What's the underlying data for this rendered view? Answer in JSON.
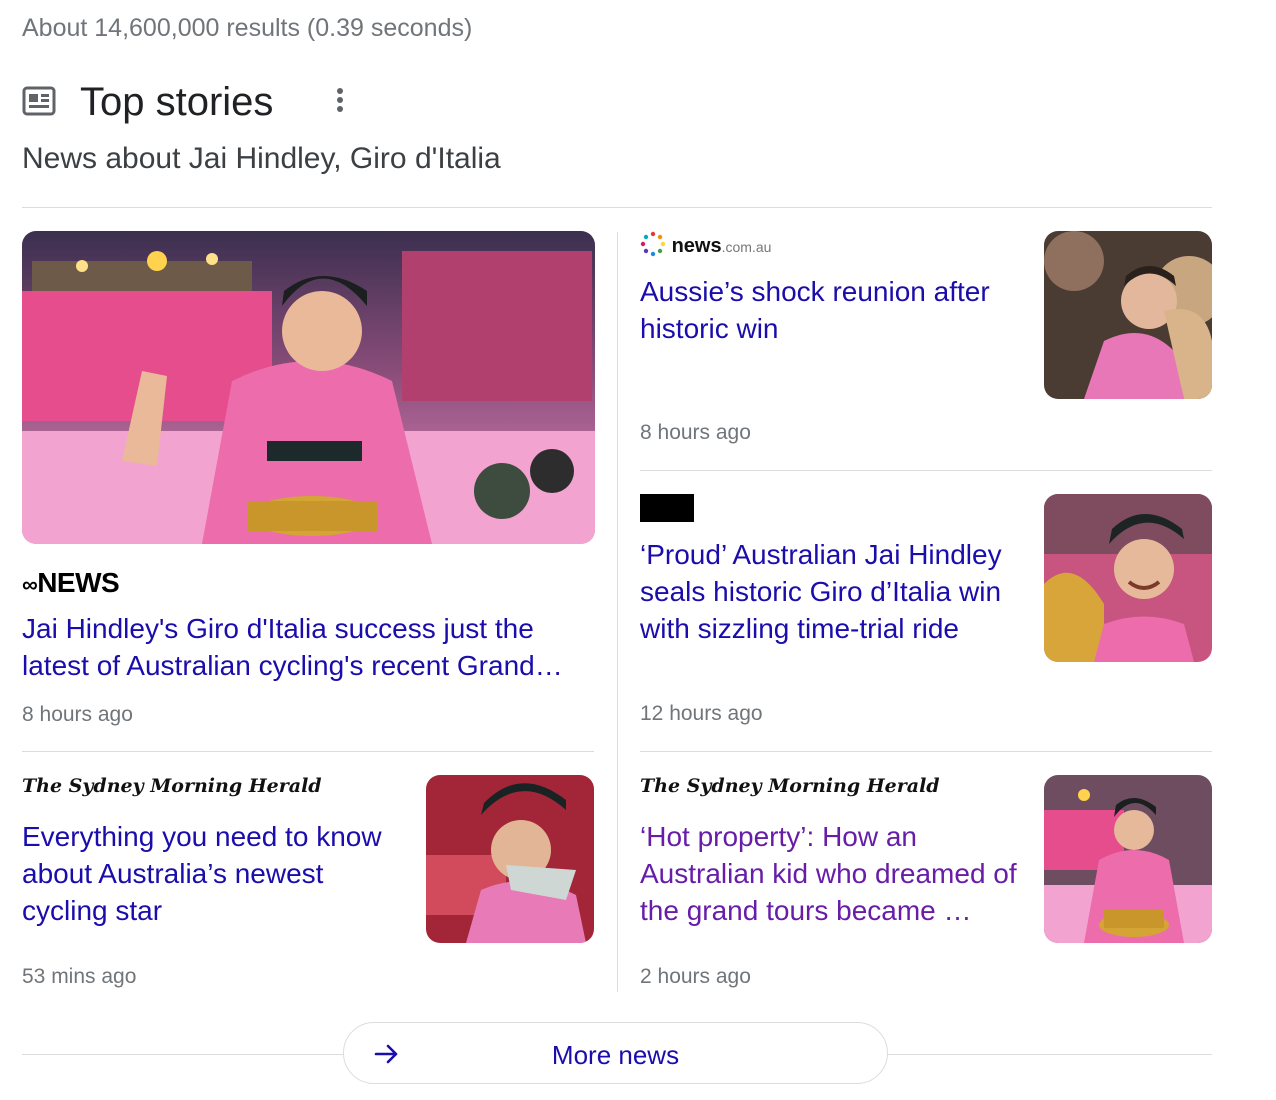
{
  "result_stats": "About 14,600,000 results (0.39 seconds)",
  "top_stories": {
    "title": "Top stories",
    "subtitle": "News about Jai Hindley, Giro d'Italia",
    "more_button": "More news"
  },
  "stories": [
    {
      "publisher": "NEWS",
      "headline": "Jai Hindley's Giro d'Italia success just the latest of Australian cycling's recent Grand…",
      "age": "8 hours ago"
    },
    {
      "publisher": "news",
      "publisher_suffix": ".com.au",
      "headline": "Aussie’s shock reunion after historic win",
      "age": "8 hours ago"
    },
    {
      "publisher": "",
      "headline": "‘Proud’ Australian Jai Hindley seals historic Giro d’Italia win with sizzling time-trial ride",
      "age": "12 hours ago"
    },
    {
      "publisher": "The Sydney Morning Herald",
      "headline": "Everything you need to know about Australia’s newest cycling star",
      "age": "53 mins ago"
    },
    {
      "publisher": "The Sydney Morning Herald",
      "headline": "‘Hot property’: How an Australian kid who dreamed of the grand tours became …",
      "age": "2 hours ago"
    }
  ],
  "colors": {
    "link": "#1a0dab",
    "visited": "#681da8",
    "meta": "#70757a",
    "jersey_pink": "#e96fb0"
  },
  "icons": [
    "news-icon",
    "more-vert-icon",
    "arrow-right-icon"
  ]
}
